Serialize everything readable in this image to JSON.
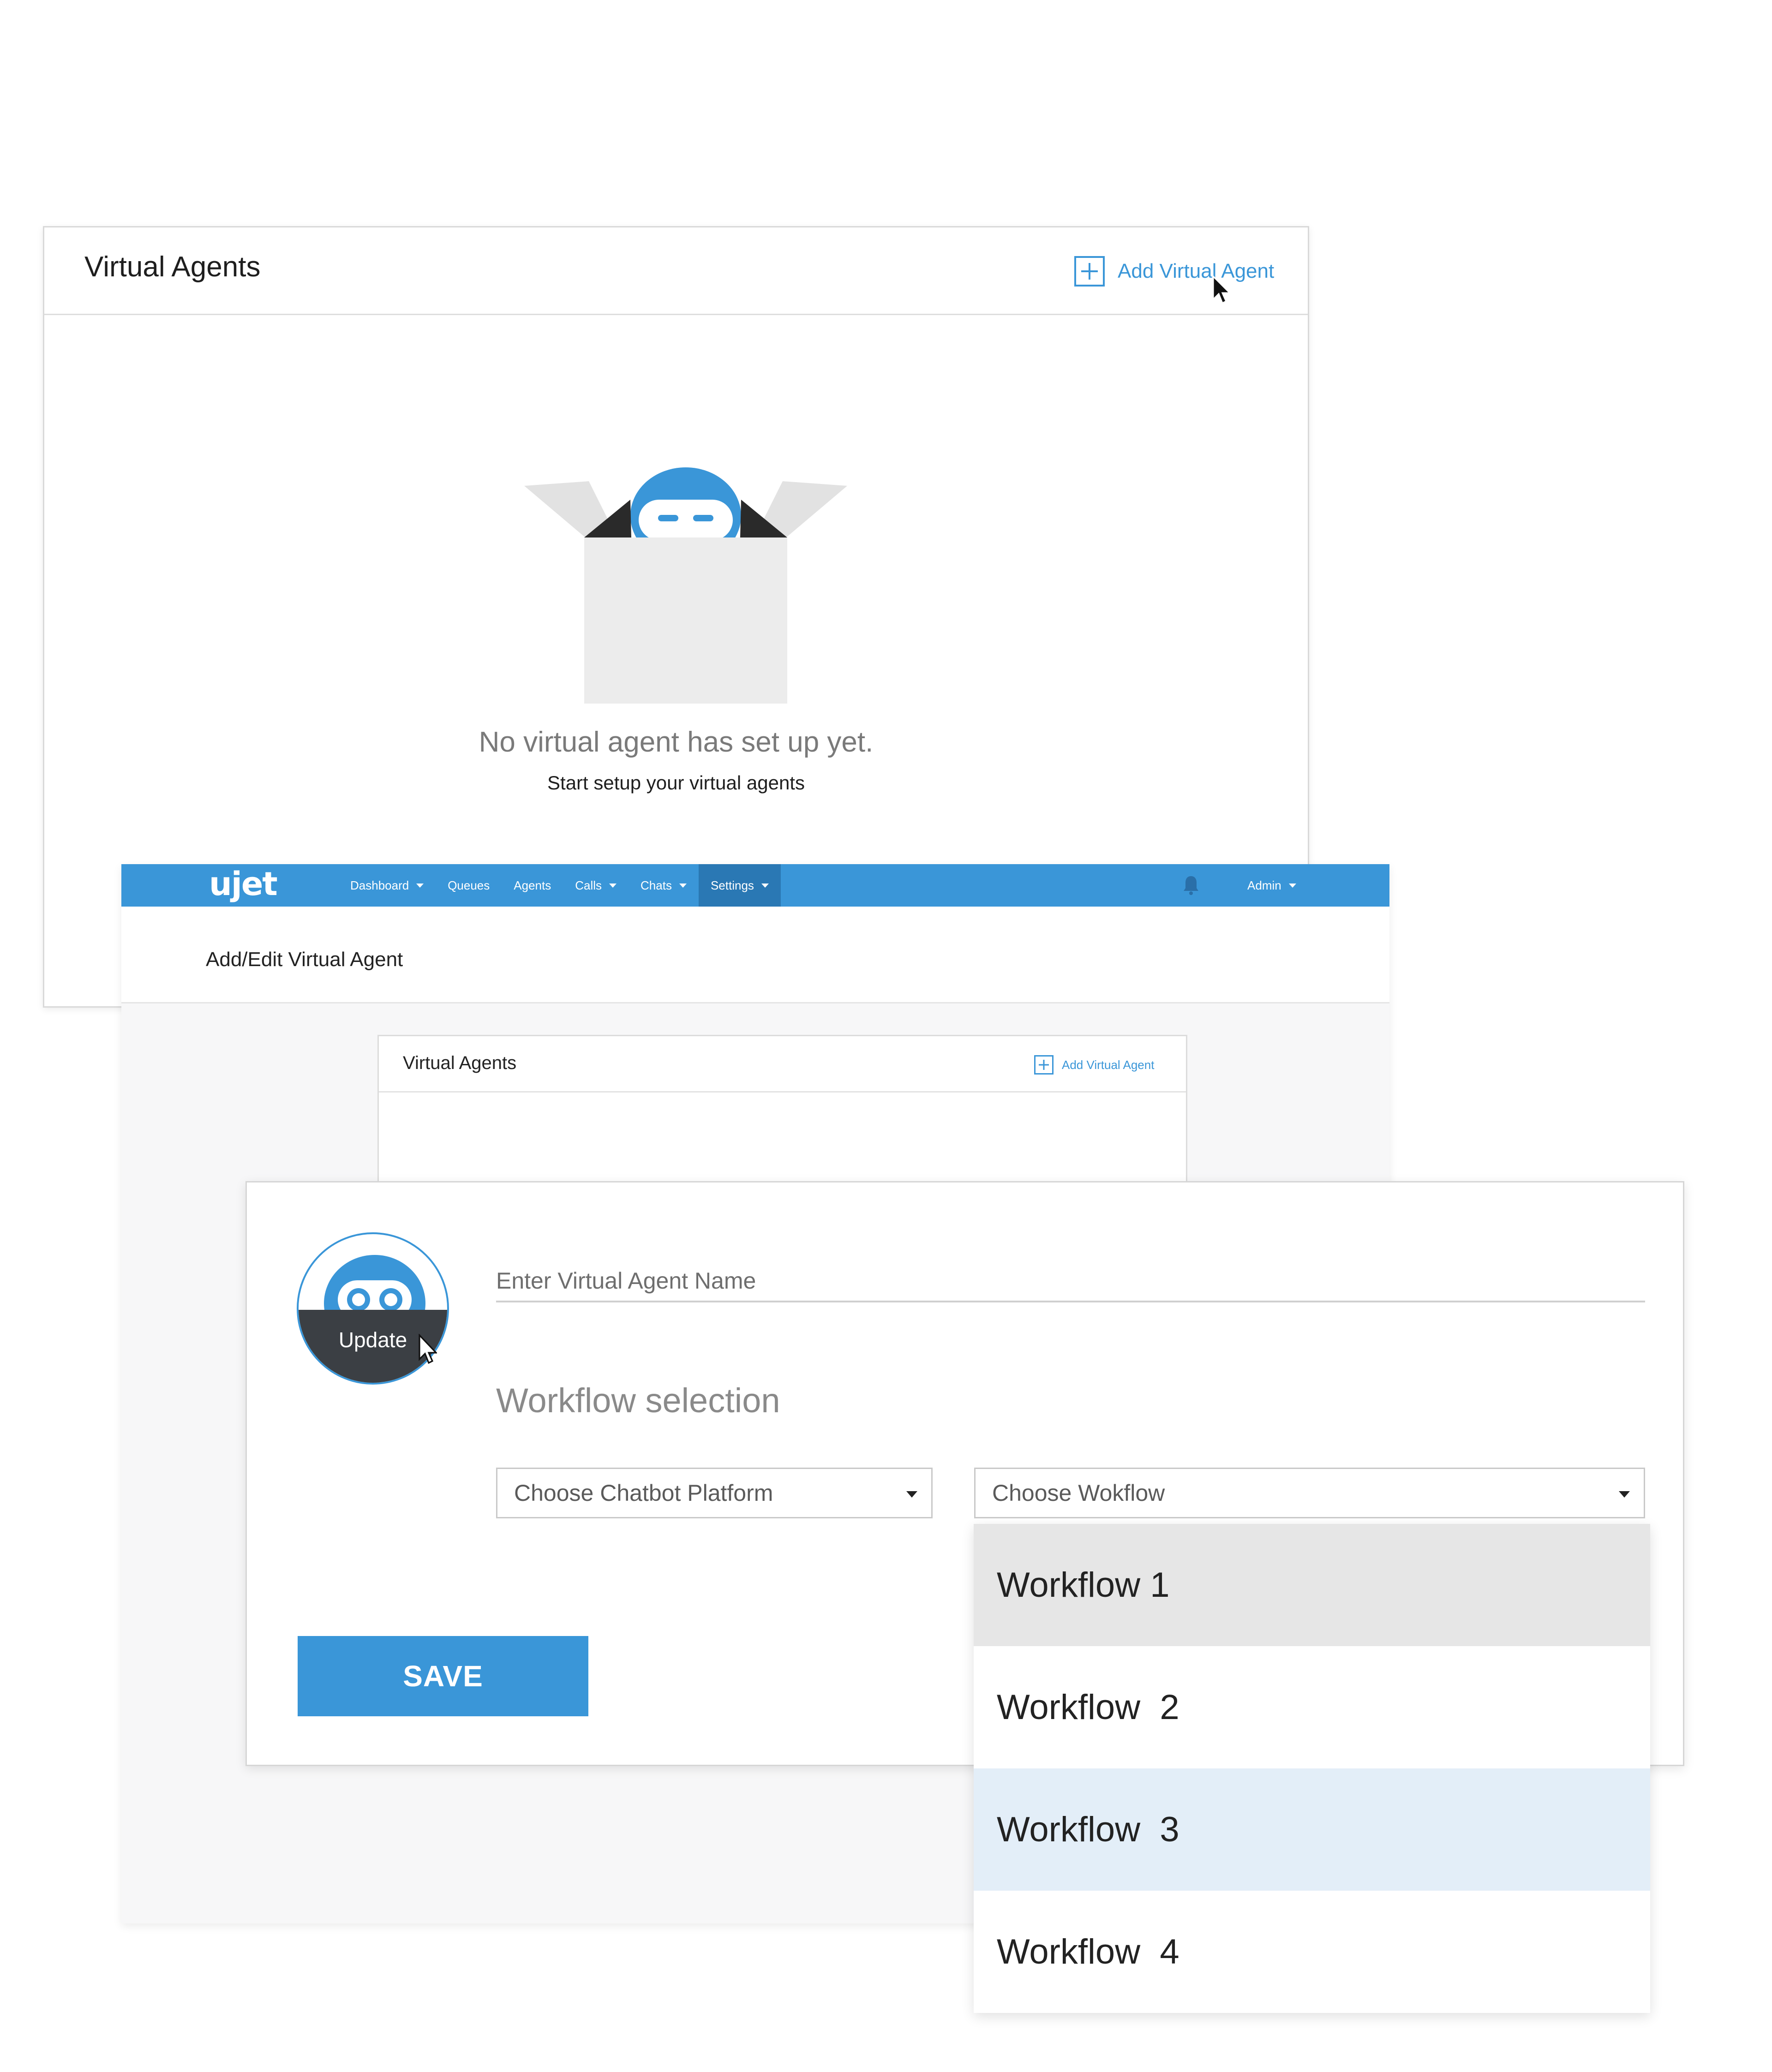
{
  "panel_list": {
    "title": "Virtual Agents",
    "add_label": "Add Virtual Agent",
    "empty_title": "No virtual agent has set up yet.",
    "empty_subtitle": "Start setup your virtual agents"
  },
  "navbar": {
    "logo": "ujet",
    "items": [
      {
        "label": "Dashboard",
        "has_dropdown": true
      },
      {
        "label": "Queues",
        "has_dropdown": false
      },
      {
        "label": "Agents",
        "has_dropdown": false
      },
      {
        "label": "Calls",
        "has_dropdown": true
      },
      {
        "label": "Chats",
        "has_dropdown": true
      },
      {
        "label": "Settings",
        "has_dropdown": true,
        "active": true
      }
    ],
    "user": "Admin"
  },
  "page": {
    "title": "Add/Edit Virtual Agent"
  },
  "inner_card": {
    "title": "Virtual Agents",
    "add_label": "Add Virtual Agent"
  },
  "form": {
    "avatar_action": "Update",
    "name_placeholder": "Enter Virtual Agent Name",
    "workflow_section_label": "Workflow selection",
    "platform_placeholder": "Choose Chatbot Platform",
    "workflow_placeholder": "Choose Wokflow",
    "save_label": "SAVE"
  },
  "workflow_options": [
    {
      "label": "Workflow 1",
      "state": "hovered"
    },
    {
      "label": "Workflow  2",
      "state": "normal"
    },
    {
      "label": "Workflow  3",
      "state": "selected"
    },
    {
      "label": "Workflow  4",
      "state": "normal"
    }
  ],
  "colors": {
    "accent": "#3a96d8",
    "nav_active": "#2a78b4",
    "option_hover": "#e6e6e6",
    "option_selected": "#e3eef8"
  }
}
